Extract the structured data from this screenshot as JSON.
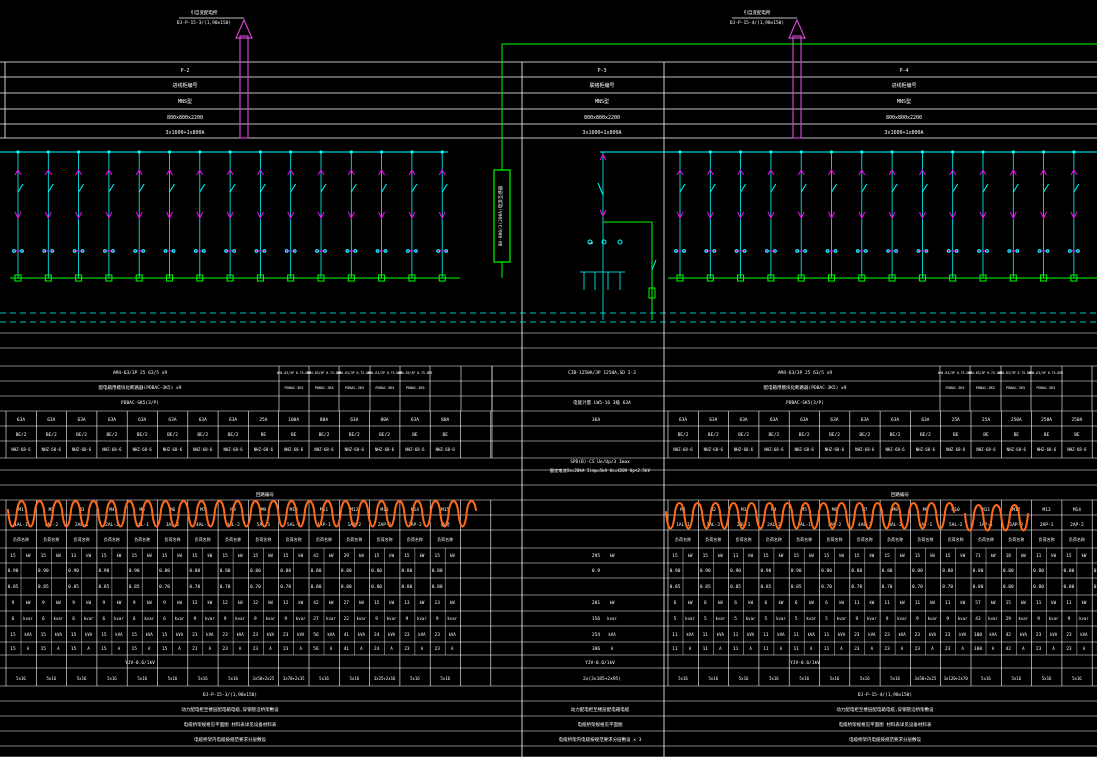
{
  "colors": {
    "background": "#000000",
    "grid": "#ffffff",
    "busbar": "#00ffff",
    "breaker": "#00ffff",
    "tag": "#ff00ff",
    "terminal": "#00ff00",
    "feeder_arrow": "#cc44cc",
    "handwriting": "#ff6a1a",
    "dashed": "#00ffff"
  },
  "icons": {
    "feeder_arrow": "upward-feeder-arrow-icon",
    "breaker": "breaker-switch-icon",
    "terminal": "terminal-box-icon",
    "spd": "surge-protector-icon"
  },
  "panels": [
    {
      "id": "left",
      "feeder_label": "引自变配电所",
      "feeder_cable": "DJ-P-15-3/(1,90x150)",
      "header_rows": [
        "P-2",
        "进线柜编号",
        "MNS型",
        "800x800x2200",
        "3x1600+1x800A"
      ],
      "circuit_count": 15
    },
    {
      "id": "right",
      "feeder_label": "引自变配电所",
      "feeder_cable": "DJ-P-15-4/(1,90x150)",
      "header_rows": [
        "P-4",
        "进线柜编号",
        "MNS型",
        "800x800x2200",
        "3x1600+1x800A"
      ],
      "circuit_count": 14
    }
  ],
  "center": {
    "header_rows": [
      "P-3",
      "联络柜编号",
      "MNS型",
      "800x800x2200",
      "3x1600+1x800A"
    ],
    "bus_coupler_label": "BH-800/3(200A)电流互感器",
    "spec_line1": "CIB-1250A/3P 1250A,SD I-3",
    "spec_line2": "电能计量 LW5-16 3级 63A",
    "breaker_rating": "36A",
    "meter_line1": "SPD(B)-CS Ue/Up/3 Imax",
    "meter_line2": "额定电流Ie=20kA Iimp=5kA Uc=420V Up<2.5kV"
  },
  "lower_left": {
    "spec_row": "AM4-63/3P 25 63/5 x9",
    "spec_row2": "配电箱用模块化断路器(PDBAC-3K5) x9",
    "spec_row3": "PDBAC-SK5(3/P)",
    "side_specs": [
      "AM4-63/3P 0.75-DM5",
      "AM4-63/3P 0.75-DM5",
      "AM4-63/3P 0.75-DM5",
      "AM4-63/3P 0.75-DM5",
      "AM4-63/3P 0.75-DM5"
    ],
    "side_pd": [
      "PDBAC-3K5",
      "PDBAC-3K5",
      "PDBAC-3K5",
      "PDBAC-3K5",
      "PDBAC-3K5"
    ],
    "ratings": [
      "63A",
      "63A",
      "63A",
      "63A",
      "63A",
      "63A",
      "63A",
      "63A",
      "25A",
      "100A",
      "80A",
      "63A",
      "80A",
      "63A",
      "80A"
    ],
    "poles": [
      "BE/2",
      "BE/2",
      "BE/2",
      "BE/2",
      "BE/2",
      "BE/2",
      "BE/2",
      "BE/2",
      "BE",
      "BE",
      "BE/2",
      "BE/2",
      "BE/2",
      "BE",
      "BE"
    ],
    "models": [
      "NHZ-68-6",
      "NHZ-68-6",
      "NHZ-68-6",
      "NHZ-68-6",
      "NHZ-68-6",
      "NHZ-68-6",
      "NHZ-68-6",
      "NHZ-68-6",
      "NHZ-68-6",
      "NHZ-68-6",
      "NHZ-68-6",
      "NHZ-68-6",
      "NHZ-68-6",
      "NHZ-68-6",
      "NHZ-68-6"
    ]
  },
  "lower_right": {
    "spec_row": "AM4-63/3P 25 63/5 x9",
    "spec_row2": "配电箱用模块化断路器(PDBAC-3K5) x9",
    "spec_row3": "PDBAC-SK5(3/P)",
    "side_specs": [
      "AM4-63/3P 0.75-DM5",
      "AM4-63/3P 0.75-DM5",
      "AM4-63/3P 0.75-DM5",
      "AM4-63/3P 0.75-DM5"
    ],
    "side_pd": [
      "PDBAC-3K5",
      "PDBAC-3K5",
      "PDBAC-3K5",
      "PDBAC-3K5"
    ],
    "ratings": [
      "63A",
      "63A",
      "63A",
      "63A",
      "63A",
      "63A",
      "63A",
      "63A",
      "63A",
      "25A",
      "25A",
      "250A",
      "250A",
      "250A"
    ],
    "poles": [
      "BE/2",
      "BE/2",
      "BE/2",
      "BE/2",
      "BE/2",
      "BE/2",
      "BE/2",
      "BE/2",
      "BE/2",
      "BE",
      "BE",
      "BE",
      "BE",
      "BE"
    ],
    "models": [
      "NHZ-68-6",
      "NHZ-68-6",
      "NHZ-68-6",
      "NHZ-68-6",
      "NHZ-68-6",
      "NHZ-68-6",
      "NHZ-68-6",
      "NHZ-68-6",
      "NHZ-68-6",
      "NHZ-68-6",
      "NHZ-68-6",
      "NHZ-68-6",
      "NHZ-68-6",
      "NHZ-68-6"
    ]
  },
  "tables": {
    "left_title": "回路编号",
    "right_title": "回路编号",
    "left_circuits": [
      "M1",
      "M2",
      "M3",
      "M4",
      "M5",
      "M6",
      "M7",
      "M8",
      "M9",
      "M10",
      "M11",
      "M12",
      "M13",
      "M14",
      "M15"
    ],
    "right_circuits": [
      "M1",
      "M2",
      "M3",
      "M4",
      "M5",
      "M6",
      "M7",
      "M8",
      "M9",
      "M10",
      "M11",
      "M12",
      "M13",
      "M14",
      "M15"
    ],
    "left_names": [
      "1AL-1",
      "1AL-2",
      "2AL-1",
      "2AL-2",
      "3AL-1",
      "3AL-2",
      "4AL-1",
      "4AL-2",
      "5AL-1",
      "5AL-2",
      "1AP-1",
      "1AP-2",
      "2AP-1",
      "2AP-2",
      "备用"
    ],
    "right_names": [
      "1AL-1",
      "1AL-2",
      "2AL-1",
      "2AL-2",
      "3AL-1",
      "3AL-2",
      "4AL-1",
      "4AL-2",
      "5AL-1",
      "5AL-2",
      "1AP-1",
      "1AP-2",
      "2AP-1",
      "2AP-2",
      "备用"
    ],
    "left_kw": [
      "15",
      "15",
      "11",
      "15",
      "15",
      "15",
      "15",
      "15",
      "15",
      "15",
      "42",
      "29",
      "15",
      "15",
      "15"
    ],
    "right_kw": [
      "15",
      "15",
      "11",
      "15",
      "15",
      "15",
      "15",
      "15",
      "15",
      "15",
      "71",
      "18",
      "11",
      "15",
      "15"
    ],
    "left_kx": [
      "0.90",
      "0.90",
      "0.90",
      "0.90",
      "0.90",
      "0.80",
      "0.80",
      "0.80",
      "0.80",
      "0.80",
      "0.80",
      "0.80",
      "0.80",
      "0.80",
      "0.80"
    ],
    "right_kx": [
      "0.90",
      "0.90",
      "0.90",
      "0.90",
      "0.90",
      "0.80",
      "0.80",
      "0.80",
      "0.80",
      "0.80",
      "0.80",
      "0.80",
      "0.80",
      "0.80",
      "0.80"
    ],
    "left_cos": [
      "0.85",
      "0.85",
      "0.85",
      "0.85",
      "0.85",
      "0.70",
      "0.70",
      "0.70",
      "0.70",
      "0.70",
      "0.80",
      "0.80",
      "0.80",
      "0.80",
      "0.80"
    ],
    "right_cos": [
      "0.85",
      "0.85",
      "0.85",
      "0.85",
      "0.85",
      "0.70",
      "0.70",
      "0.70",
      "0.70",
      "0.70",
      "0.80",
      "0.80",
      "0.80",
      "0.80",
      "0.80"
    ],
    "left_pjs": [
      "9",
      "9",
      "9",
      "9",
      "9",
      "9",
      "12",
      "12",
      "12",
      "12",
      "42",
      "27",
      "15",
      "13",
      "13"
    ],
    "right_pjs": [
      "6",
      "6",
      "6",
      "6",
      "6",
      "6",
      "11",
      "11",
      "11",
      "11",
      "57",
      "15",
      "11",
      "11",
      "11"
    ],
    "left_qjs": [
      "6",
      "6",
      "6",
      "6",
      "6",
      "6",
      "9",
      "9",
      "9",
      "9",
      "27",
      "22",
      "9",
      "9",
      "9"
    ],
    "right_qjs": [
      "5",
      "5",
      "5",
      "5",
      "5",
      "5",
      "9",
      "9",
      "9",
      "9",
      "43",
      "29",
      "9",
      "9",
      "9"
    ],
    "left_ijs": [
      "15",
      "15",
      "15",
      "15",
      "15",
      "15",
      "21",
      "23",
      "23",
      "23",
      "56",
      "41",
      "24",
      "23",
      "23"
    ],
    "right_ijs": [
      "11",
      "11",
      "11",
      "11",
      "11",
      "11",
      "23",
      "23",
      "23",
      "23",
      "100",
      "42",
      "23",
      "23",
      "23"
    ],
    "center_values": [
      "295",
      "0.9",
      "201",
      "156",
      "254",
      "386"
    ],
    "center_units": [
      "kW",
      "",
      "kW",
      "kvar",
      "kVA",
      "A"
    ],
    "cable_left": [
      "5x16",
      "5x16",
      "5x16",
      "5x16",
      "5x16",
      "5x16",
      "5x16",
      "5x16",
      "3x50+2x25",
      "3x70+2x35",
      "5x16",
      "5x16",
      "3x25+2x16",
      "5x16",
      "5x16"
    ],
    "cable_right": [
      "5x16",
      "5x16",
      "5x16",
      "5x16",
      "5x16",
      "5x16",
      "5x16",
      "5x16",
      "3x50+2x25",
      "3x120+2x70",
      "5x16",
      "5x16",
      "5x16",
      "5x16",
      "5x16"
    ],
    "cable_type_left": "YJV-0.6/1kV",
    "cable_type_right": "YJV-0.6/1kV",
    "center_cable": "2x(3x185+2x95)",
    "center_cable_type": "YJV-0.6/1kV",
    "footer_left": [
      "DJ-P-15-3/(1,90x150)",
      "动力配电柜至楼层配电箱电缆,穿钢管沿桥架敷设",
      "电缆桥架规格见平面图 材料表详见设备材料表",
      "电缆桥架内电缆按规范要求分层敷设"
    ],
    "footer_center": [
      "",
      "动力配电柜至楼层配电箱电缆",
      "电缆桥架规格见平面图",
      "电缆桥架内电缆按规范要求分层敷设 x 3"
    ],
    "footer_right": [
      "DJ-P-15-4/(1,90x150)",
      "动力配电柜至楼层配电箱电缆,穿钢管沿桥架敷设",
      "电缆桥架规格见平面图 材料表详见设备材料表",
      "电缆桥架内电缆按规范要求分层敷设"
    ]
  },
  "row_labels": {
    "power_col": "负荷名称",
    "kw_col": "kW"
  }
}
